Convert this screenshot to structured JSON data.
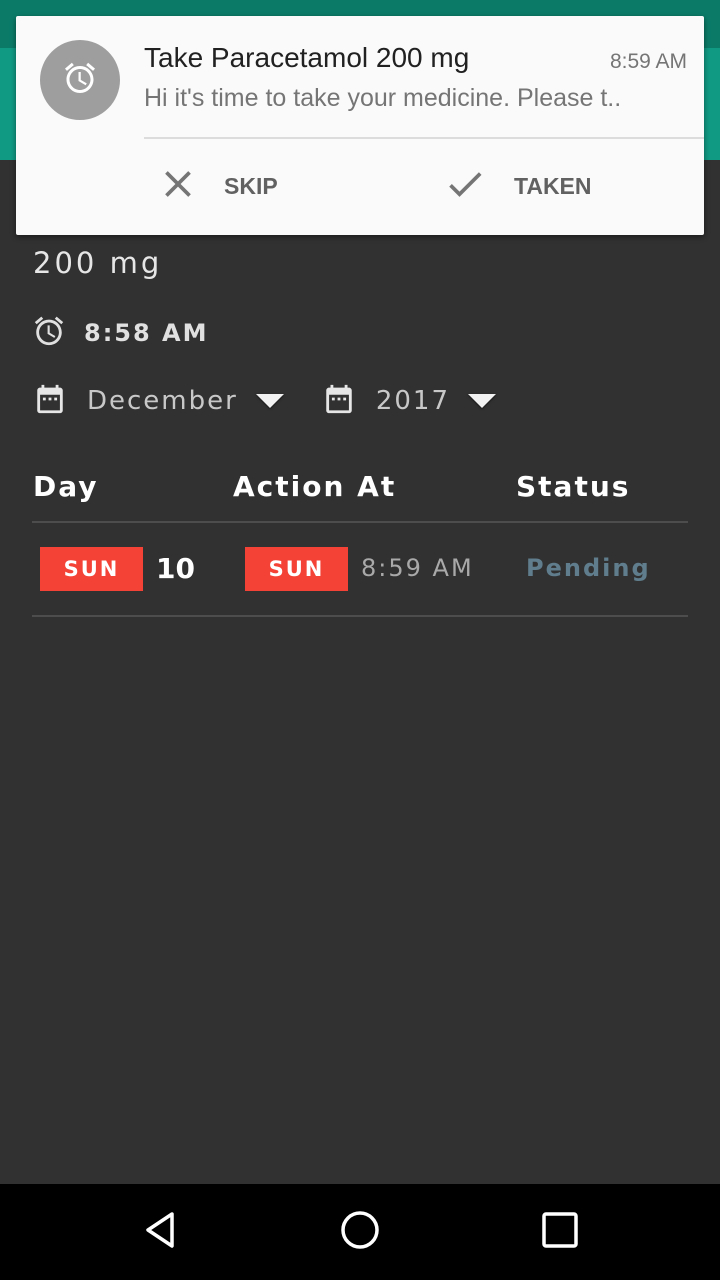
{
  "notification": {
    "title": "Take Paracetamol 200 mg",
    "time": "8:59 AM",
    "text": "Hi it's time to take your medicine. Please t..",
    "actions": {
      "skip": "SKIP",
      "taken": "TAKEN"
    }
  },
  "medicine": {
    "dose": "200 mg",
    "reminder_time": "8:58 AM"
  },
  "filters": {
    "month": "December",
    "year": "2017"
  },
  "table": {
    "headers": {
      "day": "Day",
      "action_at": "Action At",
      "status": "Status"
    },
    "rows": [
      {
        "day_badge": "SUN",
        "day_number": "10",
        "action_badge": "SUN",
        "action_time": "8:59 AM",
        "status": "Pending"
      }
    ]
  },
  "colors": {
    "status_bar": "#0b7b68",
    "app_bar": "#109a84",
    "background": "#313131",
    "badge": "#f44336",
    "pending": "#5f7d8c"
  },
  "icons": [
    "alarm-icon",
    "calendar-icon",
    "dropdown-caret-icon",
    "close-icon",
    "check-icon",
    "back-icon",
    "home-icon",
    "recents-icon"
  ]
}
